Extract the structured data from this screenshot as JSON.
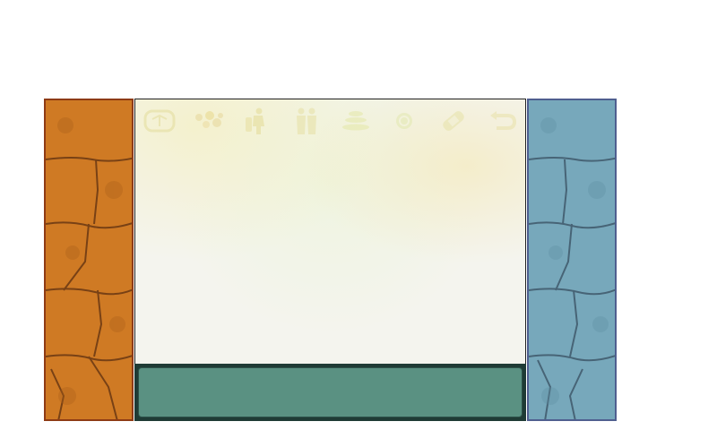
{
  "colors": {
    "left_pillar": "#cf7a24",
    "right_pillar": "#77a8bb",
    "board_background": "#f4f4ee",
    "icon_tint": "#e8e2a0",
    "panel": "#5a9182",
    "panel_border": "#1f3b35"
  },
  "board": {
    "icons": [
      {
        "name": "scale-icon"
      },
      {
        "name": "flower-icon"
      },
      {
        "name": "person-carrying-icon"
      },
      {
        "name": "two-people-icon"
      },
      {
        "name": "stacked-plates-icon"
      },
      {
        "name": "coin-icon"
      },
      {
        "name": "bandage-icon"
      },
      {
        "name": "return-arrow-icon"
      }
    ]
  }
}
